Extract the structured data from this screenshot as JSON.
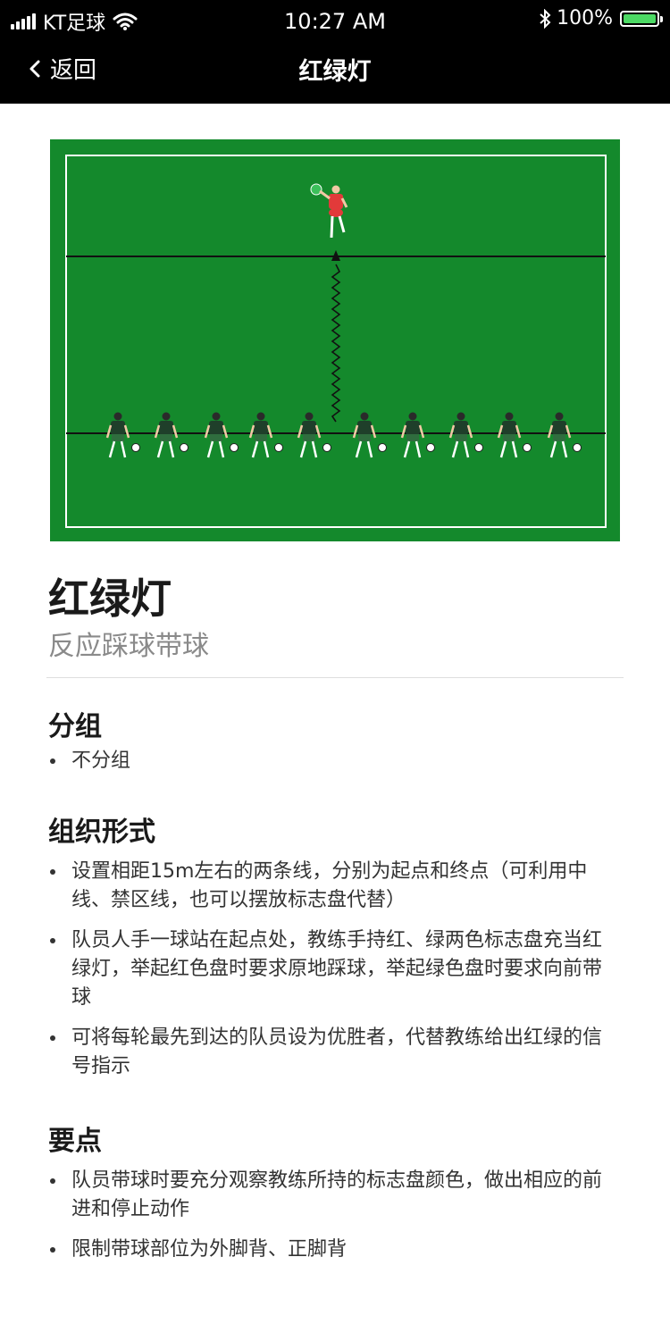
{
  "status_bar": {
    "carrier": "KT足球",
    "time": "10:27 AM",
    "battery": "100%",
    "battery_level": 1.0,
    "icons": [
      "signal-icon",
      "wifi-icon",
      "bluetooth-icon",
      "battery-icon"
    ]
  },
  "nav": {
    "back_label": "返回",
    "title": "红绿灯"
  },
  "drill": {
    "title": "红绿灯",
    "subtitle": "反应踩球带球"
  },
  "sections": {
    "grouping": {
      "heading": "分组",
      "items": [
        "不分组"
      ]
    },
    "organization": {
      "heading": "组织形式",
      "items": [
        "设置相距15m左右的两条线，分别为起点和终点（可利用中线、禁区线，也可以摆放标志盘代替）",
        "队员人手一球站在起点处，教练手持红、绿两色标志盘充当红绿灯，举起红色盘时要求原地踩球，举起绿色盘时要求向前带球",
        "可将每轮最先到达的队员设为优胜者，代替教练给出红绿的信号指示"
      ]
    },
    "key_points": {
      "heading": "要点",
      "items": [
        "队员带球时要充分观察教练所持的标志盘颜色，做出相应的前进和停止动作",
        "限制带球部位为外脚背、正脚背"
      ]
    }
  },
  "colors": {
    "pitch": "#14892c",
    "player_kit": "#1f3f2a",
    "coach_kit": "#e23a3a",
    "muted_text": "#8a8a8a"
  }
}
